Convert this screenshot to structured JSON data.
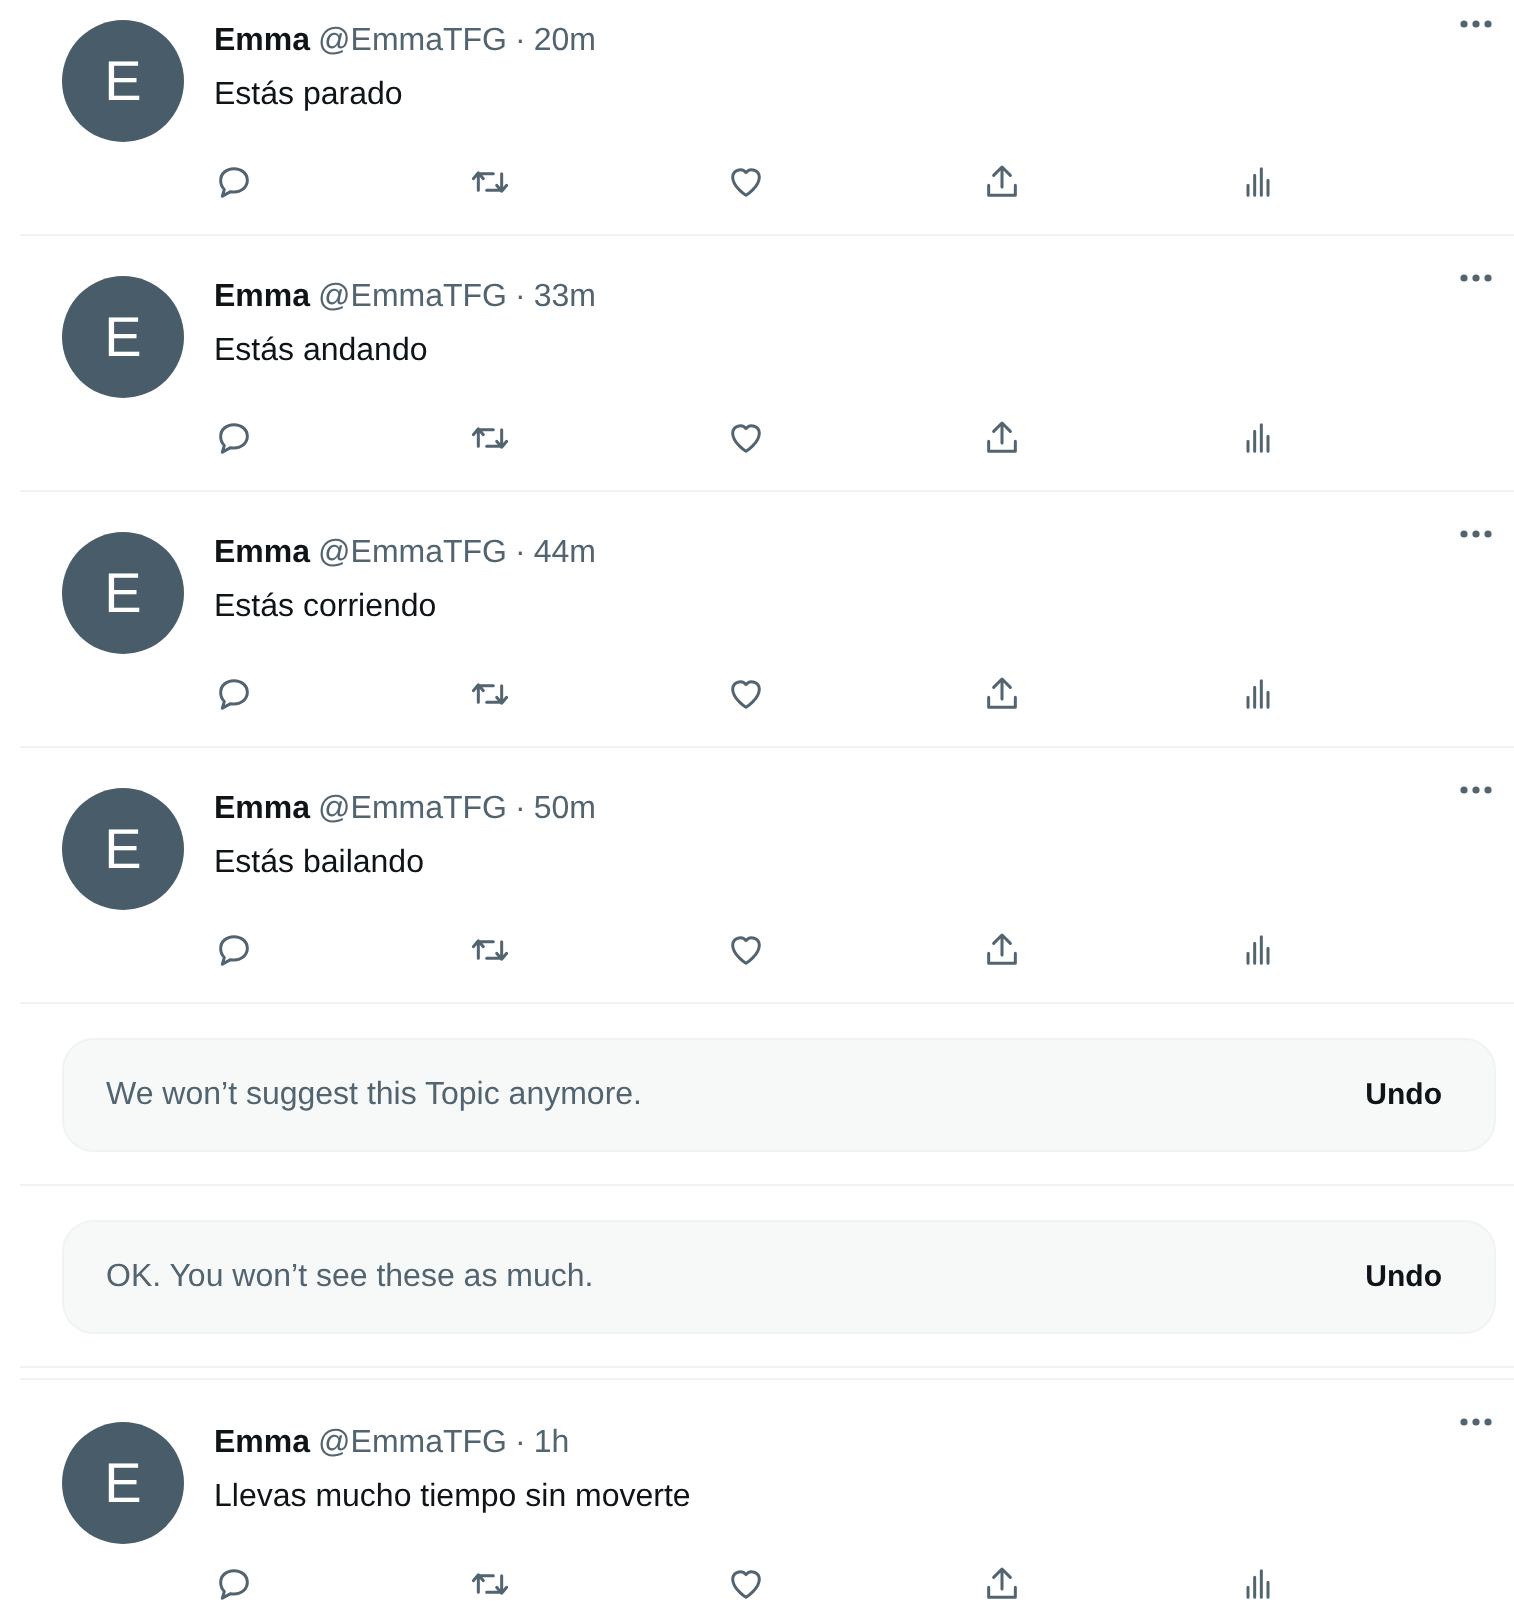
{
  "feed": [
    {
      "kind": "tweet",
      "avatar_letter": "E",
      "name": "Emma",
      "handle": "@EmmaTFG",
      "separator": "·",
      "time": "20m",
      "text": "Estás parado"
    },
    {
      "kind": "tweet",
      "avatar_letter": "E",
      "name": "Emma",
      "handle": "@EmmaTFG",
      "separator": "·",
      "time": "33m",
      "text": "Estás andando"
    },
    {
      "kind": "tweet",
      "avatar_letter": "E",
      "name": "Emma",
      "handle": "@EmmaTFG",
      "separator": "·",
      "time": "44m",
      "text": "Estás corriendo"
    },
    {
      "kind": "tweet",
      "avatar_letter": "E",
      "name": "Emma",
      "handle": "@EmmaTFG",
      "separator": "·",
      "time": "50m",
      "text": "Estás bailando"
    },
    {
      "kind": "notice",
      "text": "We won’t suggest this Topic anymore.",
      "action": "Undo"
    },
    {
      "kind": "notice",
      "text": "OK. You won’t see these as much.",
      "action": "Undo"
    },
    {
      "kind": "tweet",
      "avatar_letter": "E",
      "name": "Emma",
      "handle": "@EmmaTFG",
      "separator": "·",
      "time": "1h",
      "text": "Llevas mucho tiempo sin moverte"
    }
  ]
}
